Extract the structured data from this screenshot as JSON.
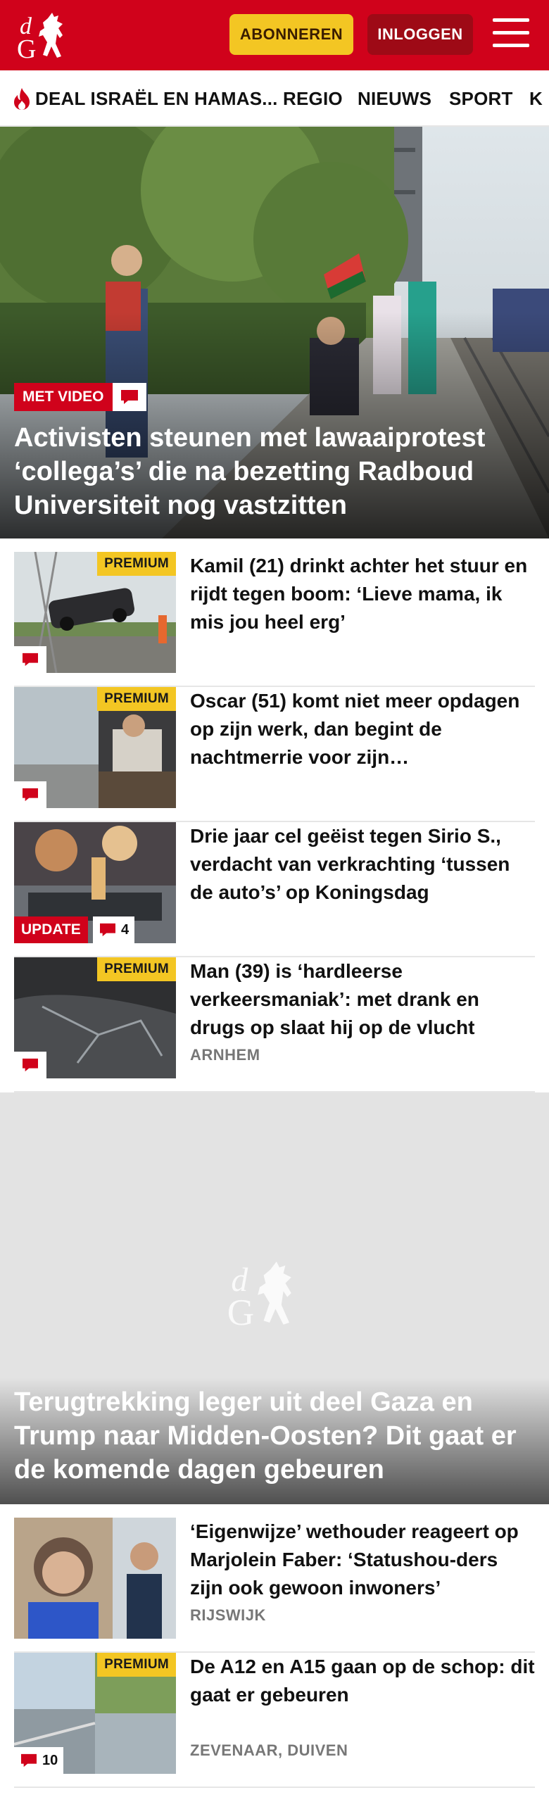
{
  "header": {
    "subscribe_label": "ABONNEREN",
    "login_label": "INLOGGEN",
    "brand_color": "#d0021b"
  },
  "nav": {
    "items": [
      {
        "label": "DEAL ISRAËL EN HAMAS...",
        "icon": "flame-icon"
      },
      {
        "label": "REGIO"
      },
      {
        "label": "NIEUWS"
      },
      {
        "label": "SPORT"
      },
      {
        "label": "K"
      }
    ]
  },
  "hero": {
    "badge": "MET VIDEO",
    "title": "Activisten steunen met lawaaiprotest ‘collega’s’ die na bezetting Radboud Universiteit nog vastzitten"
  },
  "articles": [
    {
      "headline": "Kamil (21) drinkt achter het stuur en rijdt tegen boom: ‘Lieve mama, ik mis jou heel erg’",
      "premium": "PREMIUM"
    },
    {
      "headline": "Oscar (51) komt niet meer opdagen op zijn werk, dan begint de nachtmerrie voor zijn…",
      "premium": "PREMIUM"
    },
    {
      "headline": "Drie jaar cel geëist tegen Sirio S., verdacht van verkrachting ‘tussen de auto’s’ op Koningsdag",
      "update": "UPDATE",
      "comments": "4"
    },
    {
      "headline": "Man (39) is ‘hardleerse verkeersmaniak’: met drank en drugs op slaat hij op de vlucht",
      "premium": "PREMIUM",
      "location": "ARNHEM"
    }
  ],
  "feature": {
    "title": "Terugtrekking leger uit deel Gaza en Trump naar Midden-Oosten? Dit gaat er de komende dagen gebeuren"
  },
  "articles2": [
    {
      "headline": "‘Eigenwijze’ wethouder reageert op Marjolein Faber: ‘Statushou-ders zijn ook gewoon inwoners’",
      "location": "RIJSWIJK"
    },
    {
      "headline": "De A12 en A15 gaan op de schop: dit gaat er gebeuren",
      "premium": "PREMIUM",
      "location": "ZEVENAAR, DUIVEN",
      "comments": "10"
    }
  ]
}
